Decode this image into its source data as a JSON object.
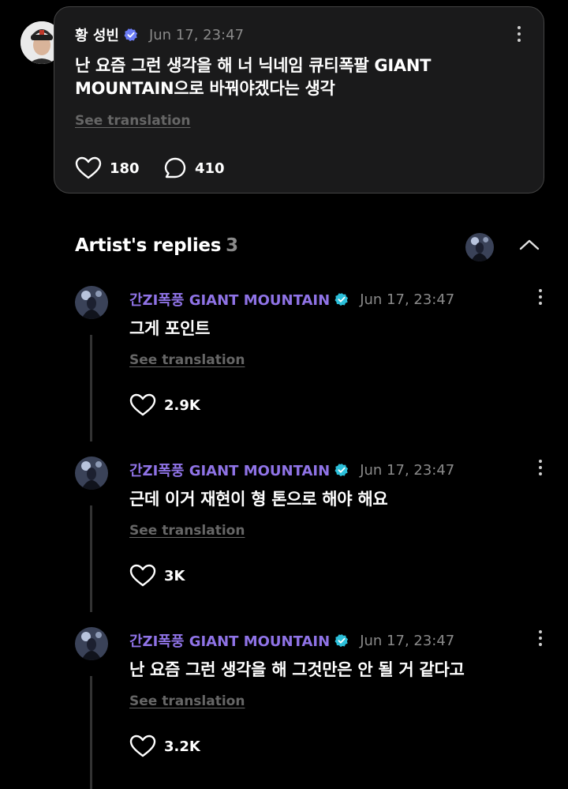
{
  "post": {
    "author": "황 성빈",
    "date": "Jun 17, 23:47",
    "body_line1": "난 요즘 그런 생각을 해 너 닉네임 큐티폭팔 GIANT",
    "body_line2": "MOUNTAIN으로 바꿔야겠다는 생각",
    "see_translation": "See translation",
    "likes": "180",
    "comments": "410"
  },
  "replies_header": {
    "label": "Artist's replies",
    "count": "3"
  },
  "replies": [
    {
      "author": "간ZI폭풍 GIANT MOUNTAIN",
      "date": "Jun 17, 23:47",
      "text": "그게 포인트",
      "see_translation": "See translation",
      "likes": "2.9K"
    },
    {
      "author": "간ZI폭풍 GIANT MOUNTAIN",
      "date": "Jun 17, 23:47",
      "text": "근데 이거 재현이 형 톤으로 해야 해요",
      "see_translation": "See translation",
      "likes": "3K"
    },
    {
      "author": "간ZI폭풍 GIANT MOUNTAIN",
      "date": "Jun 17, 23:47",
      "text": "난 요즘 그런 생각을 해 그것만은 안 될 거 같다고",
      "see_translation": "See translation",
      "likes": "3.2K"
    }
  ],
  "colors": {
    "artist_name": "#8f73e6",
    "verify_post": "#6b7cf5",
    "verify_artist": "#2bbfd9",
    "muted": "#8a8a8a"
  }
}
